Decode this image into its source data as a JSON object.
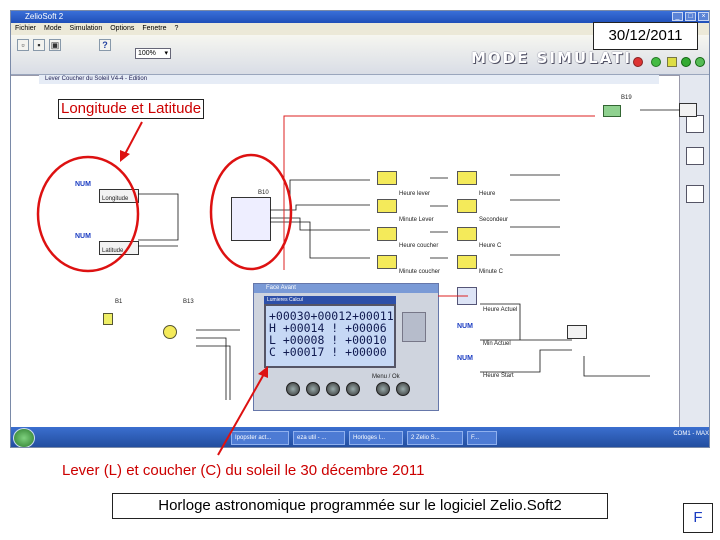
{
  "app": {
    "title": "ZelioSoft 2",
    "menu": [
      "Fichier",
      "Mode",
      "Simulation",
      "Options",
      "Fenetre",
      "?"
    ],
    "zoom": "100%",
    "mode_banner": "MODE SIMULATI",
    "date": "30/12/2011"
  },
  "diagram": {
    "num_label": "NUM",
    "inputs": [
      {
        "id": "B4",
        "label": "Longitude"
      },
      {
        "id": "B5",
        "label": "Latitude"
      }
    ],
    "block_ids": [
      "B1",
      "B19",
      "B13",
      "B10"
    ],
    "outputs": [
      "Heure lever",
      "Minute Lever",
      "Heure coucher",
      "Minute coucher"
    ],
    "right_outputs": [
      "Heure",
      "Secondeur",
      "Heure C",
      "Minute C"
    ],
    "lower_labels": [
      "Heure Actuel",
      "Min Actuel",
      "Heure Start"
    ]
  },
  "front_panel": {
    "title": "Face Avant",
    "header": "Lumieres Calcul",
    "lcd_lines": [
      "+00030+00012+00011",
      "H +00014 ! +00006",
      "L +00008 ! +00010",
      "C +00017 ! +00000"
    ],
    "menu_label": "Menu / Ok"
  },
  "taskbar": {
    "tasks": [
      "Ipopster act...",
      "eza util - ...",
      "Horloges l...",
      "2 Zelio S...",
      "F..."
    ],
    "tray": "COM1 - MAX"
  },
  "annotations": {
    "longlat": "Longitude et Latitude",
    "sunrise": "Lever (L) et coucher (C) du soleil le 30 décembre 2011",
    "footer": "Horloge astronomique programmée sur le logiciel Zelio.Soft2",
    "flag": "F"
  }
}
